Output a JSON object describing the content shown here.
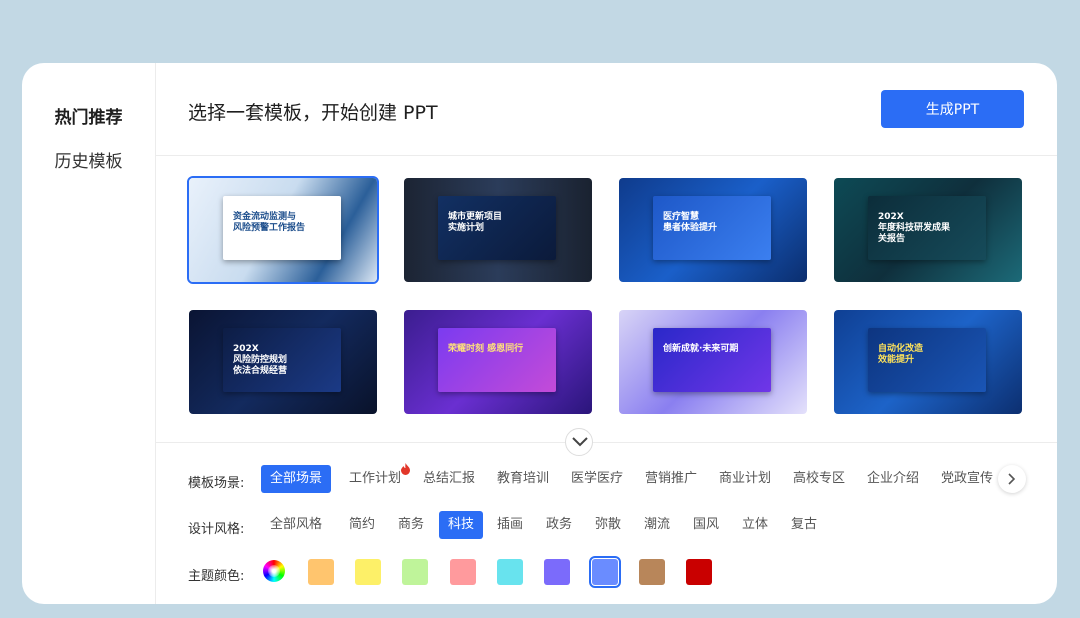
{
  "sidebar": {
    "items": [
      {
        "label": "热门推荐",
        "active": true
      },
      {
        "label": "历史模板",
        "active": false
      }
    ]
  },
  "header": {
    "title": "选择一套模板，开始创建 PPT",
    "generate_label": "生成PPT"
  },
  "templates": [
    {
      "title": "资金流动监测与\n风险预警工作报告",
      "theme": "light-blue",
      "selected": true
    },
    {
      "title": "城市更新项目\n实施计划",
      "theme": "dark-navy",
      "selected": false
    },
    {
      "title": "医疗智慧\n患者体验提升",
      "theme": "blue",
      "selected": false
    },
    {
      "title": "202X\n年度科技研发成果\n关报告",
      "theme": "teal-dark",
      "selected": false
    },
    {
      "title": "202X\n风险防控规划\n依法合规经营",
      "theme": "dark-shield",
      "selected": false
    },
    {
      "title": "荣耀时刻 感恩同行",
      "theme": "purple",
      "selected": false
    },
    {
      "title": "创新成就·未来可期",
      "theme": "violet",
      "selected": false
    },
    {
      "title": "自动化改造\n效能提升",
      "theme": "deep-blue",
      "selected": false
    }
  ],
  "filters": {
    "scene": {
      "label": "模板场景:",
      "options": [
        "全部场景",
        "工作计划",
        "总结汇报",
        "教育培训",
        "医学医疗",
        "营销推广",
        "商业计划",
        "高校专区",
        "企业介绍",
        "党政宣传"
      ],
      "selected": "全部场景",
      "hot": "工作计划"
    },
    "style": {
      "label": "设计风格:",
      "options": [
        "全部风格",
        "简约",
        "商务",
        "科技",
        "插画",
        "政务",
        "弥散",
        "潮流",
        "国风",
        "立体",
        "复古"
      ],
      "selected": "科技"
    },
    "color": {
      "label": "主题颜色:",
      "swatches": [
        "#ffc56e",
        "#fdf068",
        "#bff49a",
        "#ff9a9d",
        "#68e3ee",
        "#7b6bfb",
        "#6a8cff",
        "#b8865a",
        "#c90000"
      ],
      "selected": "#6a8cff"
    }
  },
  "icons": {
    "expand": "chevron-down-icon",
    "scroll": "chevron-right-icon",
    "hot": "fire-icon",
    "all_colors": "color-wheel-icon"
  }
}
